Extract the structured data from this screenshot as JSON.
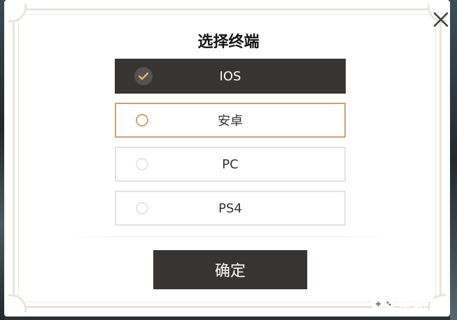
{
  "dialog": {
    "title": "选择终端",
    "options": [
      {
        "label": "IOS",
        "state": "selected"
      },
      {
        "label": "安卓",
        "state": "hover"
      },
      {
        "label": "PC",
        "state": "normal"
      },
      {
        "label": "PS4",
        "state": "normal"
      }
    ],
    "confirm_label": "确定",
    "close_icon": "close-icon"
  },
  "watermark": {
    "text": "主机屋"
  },
  "colors": {
    "selected_bg": "#373534",
    "accent": "#c9a27a",
    "check": "#e3b47a",
    "border": "#e2e2e2"
  }
}
